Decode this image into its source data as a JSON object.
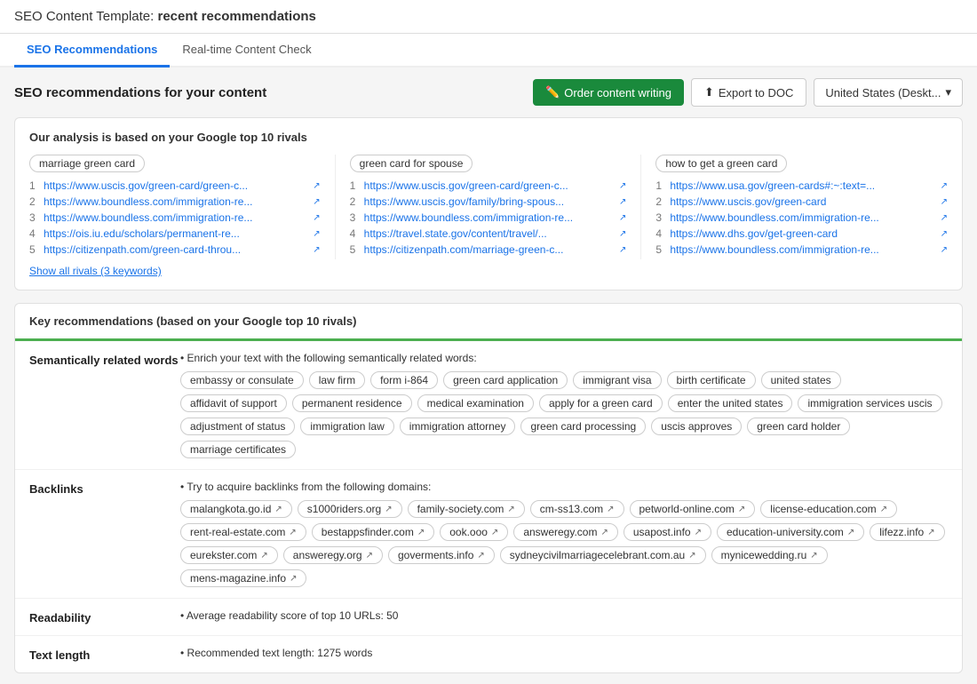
{
  "header": {
    "app_title": "SEO Content Template:",
    "app_subtitle": "recent recommendations"
  },
  "tabs": [
    {
      "label": "SEO Recommendations",
      "active": true
    },
    {
      "label": "Real-time Content Check",
      "active": false
    }
  ],
  "toolbar": {
    "section_title": "SEO recommendations for your content",
    "order_btn": "Order content writing",
    "export_btn": "Export to DOC",
    "region_label": "United States (Deskt..."
  },
  "rivals_section": {
    "title": "Our analysis is based on your Google top 10 rivals",
    "columns": [
      {
        "keyword": "marriage green card",
        "links": [
          "https://www.uscis.gov/green-card/green-c...",
          "https://www.boundless.com/immigration-re...",
          "https://www.boundless.com/immigration-re...",
          "https://ois.iu.edu/scholars/permanent-re...",
          "https://citizenpath.com/green-card-throu..."
        ]
      },
      {
        "keyword": "green card for spouse",
        "links": [
          "https://www.uscis.gov/green-card/green-c...",
          "https://www.uscis.gov/family/bring-spous...",
          "https://www.boundless.com/immigration-re...",
          "https://travel.state.gov/content/travel/...",
          "https://citizenpath.com/marriage-green-c..."
        ]
      },
      {
        "keyword": "how to get a green card",
        "links": [
          "https://www.usa.gov/green-cards#:~:text=...",
          "https://www.uscis.gov/green-card",
          "https://www.boundless.com/immigration-re...",
          "https://www.dhs.gov/get-green-card",
          "https://www.boundless.com/immigration-re..."
        ]
      }
    ],
    "show_all_label": "Show all rivals (3 keywords)"
  },
  "key_recommendations": {
    "title": "Key recommendations (based on your Google top 10 rivals)",
    "sections": [
      {
        "label": "Semantically related words",
        "intro": "• Enrich your text with the following semantically related words:",
        "tags": [
          "embassy or consulate",
          "law firm",
          "form i-864",
          "green card application",
          "immigrant visa",
          "birth certificate",
          "united states",
          "affidavit of support",
          "permanent residence",
          "medical examination",
          "apply for a green card",
          "enter the united states",
          "immigration services uscis",
          "adjustment of status",
          "immigration law",
          "immigration attorney",
          "green card processing",
          "uscis approves",
          "green card holder",
          "marriage certificates"
        ]
      },
      {
        "label": "Backlinks",
        "intro": "• Try to acquire backlinks from the following domains:",
        "domains": [
          "malangkota.go.id",
          "s1000riders.org",
          "family-society.com",
          "cm-ss13.com",
          "petworld-online.com",
          "license-education.com",
          "rent-real-estate.com",
          "bestappsfinder.com",
          "ook.ooo",
          "answeregy.com",
          "usapost.info",
          "education-university.com",
          "lifezz.info",
          "eurekster.com",
          "answeregy.org",
          "goverments.info",
          "sydneycivilmarriagecelebrant.com.au",
          "mynicewedding.ru",
          "mens-magazine.info"
        ]
      },
      {
        "label": "Readability",
        "text": "• Average readability score of top 10 URLs: ",
        "value": "50"
      },
      {
        "label": "Text length",
        "text": "• Recommended text length: ",
        "value": "1275 words"
      }
    ]
  }
}
